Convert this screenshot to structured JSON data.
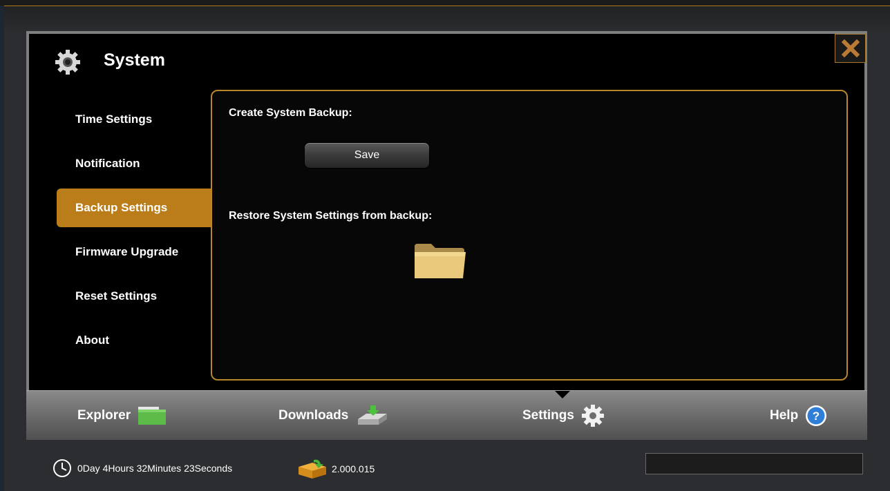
{
  "window": {
    "title": "System"
  },
  "sidebar": {
    "items": [
      {
        "label": "Time Settings",
        "active": false
      },
      {
        "label": "Notification",
        "active": false
      },
      {
        "label": "Backup Settings",
        "active": true
      },
      {
        "label": "Firmware Upgrade",
        "active": false
      },
      {
        "label": "Reset Settings",
        "active": false
      },
      {
        "label": "About",
        "active": false
      }
    ]
  },
  "panel": {
    "create_backup_label": "Create System Backup:",
    "save_label": "Save",
    "restore_label": "Restore System Settings from backup:"
  },
  "toolbar": {
    "items": [
      {
        "label": "Explorer",
        "icon": "folder-green-icon"
      },
      {
        "label": "Downloads",
        "icon": "download-drive-icon"
      },
      {
        "label": "Settings",
        "icon": "gear-icon",
        "active": true
      },
      {
        "label": "Help",
        "icon": "help-icon"
      }
    ]
  },
  "status": {
    "uptime": "0Day 4Hours 32Minutes 23Seconds",
    "version": "2.000.015",
    "progress": 0.0
  },
  "colors": {
    "accent": "#bb7c1a",
    "panel_border": "#b8862b",
    "help_blue": "#2f7fd6",
    "folder_green": "#5dbb4a"
  }
}
